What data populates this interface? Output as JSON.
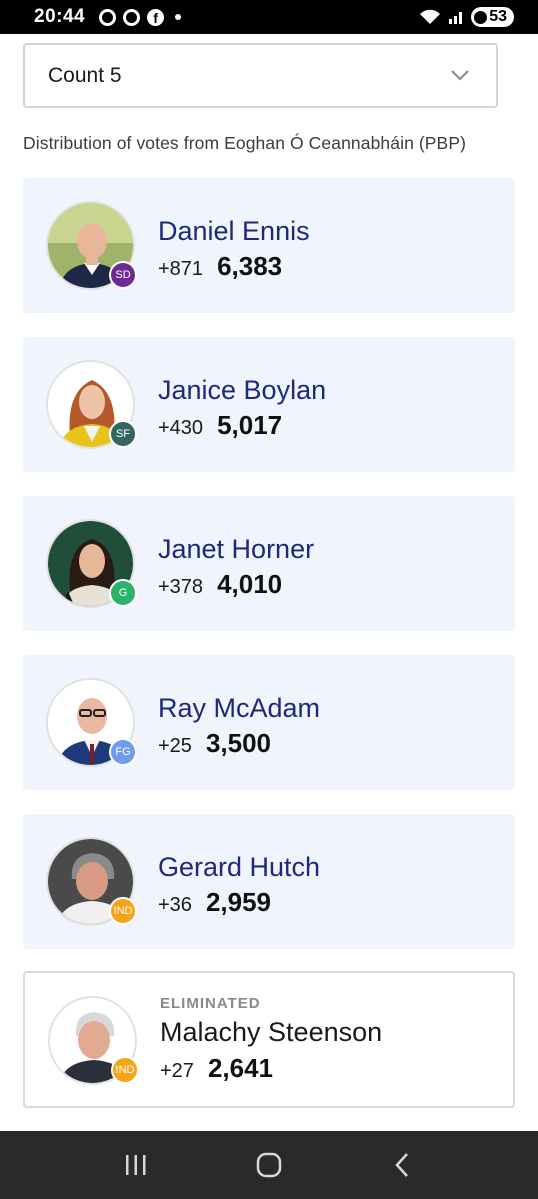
{
  "status_bar": {
    "time": "20:44",
    "battery": "53"
  },
  "count_select": {
    "label": "Count 5"
  },
  "distribution_text": "Distribution of votes from Eoghan Ó Ceannabháin (PBP)",
  "candidates": [
    {
      "name": "Daniel Ennis",
      "party": "SD",
      "party_color": "#6b2c91",
      "change": "+871",
      "total": "6,383"
    },
    {
      "name": "Janice Boylan",
      "party": "SF",
      "party_color": "#326760",
      "change": "+430",
      "total": "5,017"
    },
    {
      "name": "Janet Horner",
      "party": "G",
      "party_color": "#2bb36a",
      "change": "+378",
      "total": "4,010"
    },
    {
      "name": "Ray McAdam",
      "party": "FG",
      "party_color": "#6f9cf0",
      "change": "+25",
      "total": "3,500"
    },
    {
      "name": "Gerard Hutch",
      "party": "IND",
      "party_color": "#f5a418",
      "change": "+36",
      "total": "2,959"
    },
    {
      "name": "Malachy Steenson",
      "party": "IND",
      "party_color": "#f5a418",
      "change": "+27",
      "total": "2,641",
      "status": "ELIMINATED"
    }
  ],
  "icons": {
    "select_chevron": "chevron-down-icon",
    "nav_recent": "recent-apps-icon",
    "nav_home": "home-icon",
    "nav_back": "back-icon"
  }
}
